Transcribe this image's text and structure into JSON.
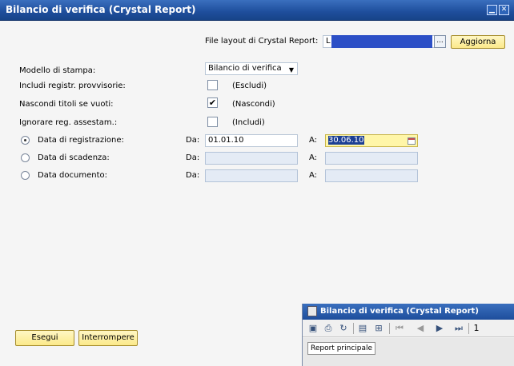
{
  "window": {
    "title": "Bilancio di verifica (Crystal Report)",
    "controls": {
      "minimize_glyph": "▁",
      "close_glyph": "✕"
    }
  },
  "layout_file": {
    "label": "File layout di Crystal Report:",
    "value": "L",
    "browse_label": "...",
    "refresh_label": "Aggiorna"
  },
  "form": {
    "print_model": {
      "label": "Modello di stampa:",
      "value": "Bilancio di verifica"
    },
    "include_provisional": {
      "label": "Includi registr. provvisorie:",
      "checked": false,
      "note": "(Escludi)"
    },
    "hide_empty_titles": {
      "label": "Nascondi titoli se vuoti:",
      "checked": true,
      "check_glyph": "✔",
      "note": "(Nascondi)"
    },
    "ignore_adjustments": {
      "label": "Ignorare reg. assestam.:",
      "checked": false,
      "note": "(Includi)"
    },
    "date_options": [
      {
        "label": "Data di registrazione:",
        "selected": true,
        "from_label": "Da:",
        "from_value": "01.01.10",
        "to_label": "A:",
        "to_value": "30.06.10"
      },
      {
        "label": "Data di scadenza:",
        "selected": false,
        "from_label": "Da:",
        "from_value": "",
        "to_label": "A:",
        "to_value": ""
      },
      {
        "label": "Data documento:",
        "selected": false,
        "from_label": "Da:",
        "from_value": "",
        "to_label": "A:",
        "to_value": ""
      }
    ]
  },
  "buttons": {
    "execute": "Esegui",
    "interrupt": "Interrompere"
  },
  "child_window": {
    "title": "Bilancio di verifica (Crystal Report)",
    "page_number": "1",
    "tab_label": "Report principale",
    "toolbar_icons": [
      "export-icon",
      "print-icon",
      "refresh-icon",
      "group-tree-icon",
      "tree-icon",
      "first-page-icon",
      "prev-page-icon",
      "next-page-icon",
      "last-page-icon"
    ]
  },
  "colors": {
    "titlebar": "#1e4e9c",
    "button_fill": "#fbe98a",
    "focused_field": "#fff6a8",
    "disabled_field": "#e4ebf5",
    "overlay": "#2c4fc6"
  }
}
